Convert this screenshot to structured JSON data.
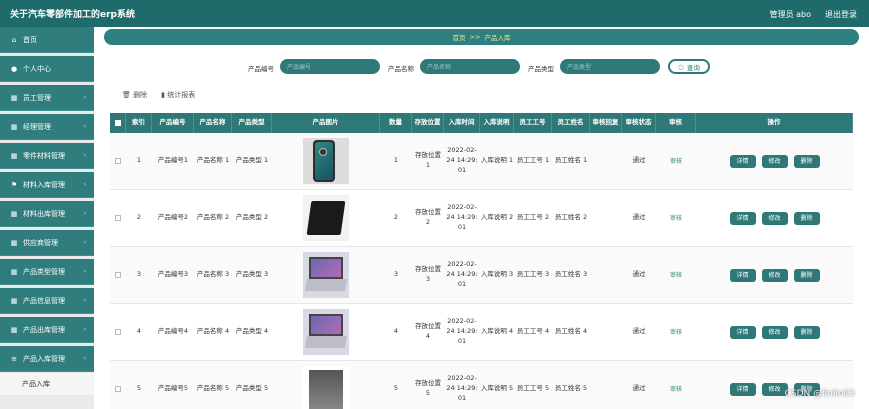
{
  "app": {
    "title": "关于汽车零部件加工的erp系统",
    "user": "管理员 abo",
    "logout": "退出登录"
  },
  "sidebar": {
    "items": [
      {
        "label": "首页",
        "icon": "home-icon",
        "glyph": "⌂"
      },
      {
        "label": "个人中心",
        "icon": "user-icon",
        "glyph": "●"
      },
      {
        "label": "员工管理",
        "icon": "grid-icon",
        "glyph": "▦"
      },
      {
        "label": "经理管理",
        "icon": "grid-icon",
        "glyph": "▦"
      },
      {
        "label": "零件材料管理",
        "icon": "grid-icon",
        "glyph": "▦"
      },
      {
        "label": "材料入库管理",
        "icon": "flag-icon",
        "glyph": "⚑"
      },
      {
        "label": "材料出库管理",
        "icon": "grid-icon",
        "glyph": "▦"
      },
      {
        "label": "供应商管理",
        "icon": "grid-icon",
        "glyph": "▦"
      },
      {
        "label": "产品类型管理",
        "icon": "grid-icon",
        "glyph": "▦"
      },
      {
        "label": "产品信息管理",
        "icon": "grid-icon",
        "glyph": "▦"
      },
      {
        "label": "产品出库管理",
        "icon": "grid-icon",
        "glyph": "▦"
      },
      {
        "label": "产品入库管理",
        "icon": "list-icon",
        "glyph": "≡"
      }
    ],
    "subitem": "产品入库"
  },
  "breadcrumb": {
    "home": "首页",
    "sep": ">>",
    "current": "产品入库"
  },
  "search": {
    "f1_label": "产品编号",
    "f1_placeholder": "产品编号",
    "f2_label": "产品名称",
    "f2_placeholder": "产品名称",
    "f3_label": "产品类型",
    "f3_placeholder": "产品类型",
    "button": "查询"
  },
  "actions": {
    "delete": "删除",
    "report": "统计报表"
  },
  "table": {
    "headers": [
      "索引",
      "产品编号",
      "产品名称",
      "产品类型",
      "产品图片",
      "数量",
      "存放位置",
      "入库时间",
      "入库说明",
      "员工工号",
      "员工姓名",
      "审核回复",
      "审核状态",
      "审核",
      "操作"
    ],
    "rows": [
      {
        "index": "1",
        "code": "产品编号1",
        "name": "产品名称 1",
        "type": "产品类型 1",
        "image": "phone",
        "qty": "1",
        "location": "存放位置 1",
        "time": "2022-02- 24 14:29: 01",
        "note": "入库说明 1",
        "emp_no": "员工工号 1",
        "emp_name": "员工姓名 1",
        "reply": "",
        "status": "通过",
        "audit": "审核"
      },
      {
        "index": "2",
        "code": "产品编号2",
        "name": "产品名称 2",
        "type": "产品类型 2",
        "image": "tablet",
        "qty": "2",
        "location": "存放位置 2",
        "time": "2022-02- 24 14:29: 01",
        "note": "入库说明 2",
        "emp_no": "员工工号 2",
        "emp_name": "员工姓名 2",
        "reply": "",
        "status": "通过",
        "audit": "审核"
      },
      {
        "index": "3",
        "code": "产品编号3",
        "name": "产品名称 3",
        "type": "产品类型 3",
        "image": "laptop",
        "qty": "3",
        "location": "存放位置 3",
        "time": "2022-02- 24 14:29: 01",
        "note": "入库说明 3",
        "emp_no": "员工工号 3",
        "emp_name": "员工姓名 3",
        "reply": "",
        "status": "通过",
        "audit": "审核"
      },
      {
        "index": "4",
        "code": "产品编号4",
        "name": "产品名称 4",
        "type": "产品类型 4",
        "image": "laptop",
        "qty": "4",
        "location": "存放位置 4",
        "time": "2022-02- 24 14:29: 01",
        "note": "入库说明 4",
        "emp_no": "员工工号 4",
        "emp_name": "员工姓名 4",
        "reply": "",
        "status": "通过",
        "audit": "审核"
      },
      {
        "index": "5",
        "code": "产品编号5",
        "name": "产品名称 5",
        "type": "产品类型 5",
        "image": "gray",
        "qty": "5",
        "location": "存放位置 5",
        "time": "2022-02- 24 14:29: 01",
        "note": "入库说明 5",
        "emp_no": "员工工号 5",
        "emp_name": "员工姓名 5",
        "reply": "",
        "status": "通过",
        "audit": "审核"
      }
    ],
    "buttons": {
      "detail": "详情",
      "edit": "修改",
      "delete": "删除"
    }
  },
  "watermark": "CSDN @linlin03",
  "colors": {
    "primary": "#2f7878",
    "header": "#1f6b6b",
    "accent_text": "#f3e58a"
  }
}
